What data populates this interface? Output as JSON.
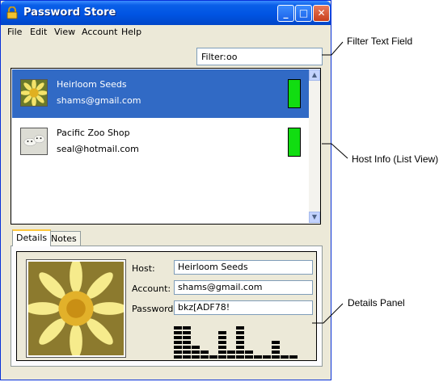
{
  "window": {
    "title": "Password Store",
    "accent": "#0054E3",
    "buttons": [
      "minimize",
      "maximize",
      "close"
    ]
  },
  "menu": [
    "File",
    "Edit",
    "View",
    "Account",
    "Help"
  ],
  "filter": {
    "label": "Filter:",
    "value": "oo"
  },
  "hosts": [
    {
      "name": "Heirloom Seeds",
      "email": "shams@gmail.com",
      "selected": true,
      "icon": "flower-thumbnail",
      "strength_color": "#11DD11"
    },
    {
      "name": "Pacific Zoo Shop",
      "email": "seal@hotmail.com",
      "selected": false,
      "icon": "seal-thumbnail",
      "strength_color": "#11DD11"
    }
  ],
  "tabs": [
    {
      "label": "Details",
      "active": true
    },
    {
      "label": "Notes",
      "active": false
    }
  ],
  "details": {
    "host_label": "Host:",
    "host_value": "Heirloom Seeds",
    "account_label": "Account:",
    "account_value": "shams@gmail.com",
    "password_label": "Password:",
    "password_value": "bkz[ADF78!"
  },
  "callouts": {
    "filter": "Filter Text Field",
    "hostinfo": "Host Info (List View)",
    "details": "Details Panel"
  }
}
